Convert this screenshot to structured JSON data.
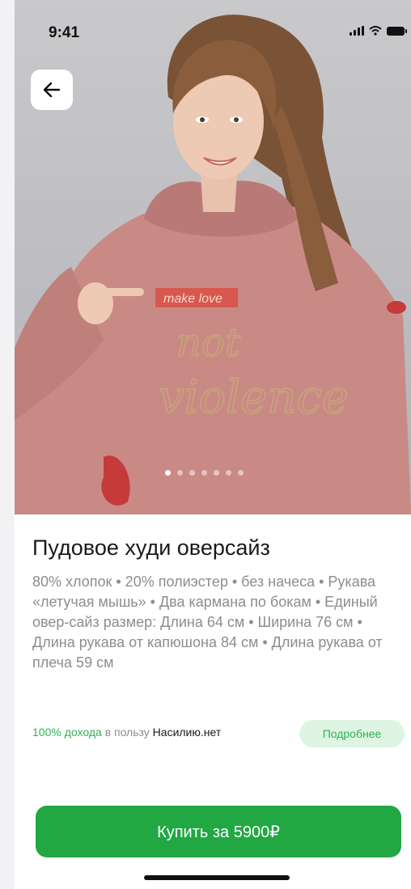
{
  "status_bar": {
    "time": "9:41"
  },
  "hero": {
    "print_text_1": "make love",
    "print_text_2": "not",
    "print_text_3": "violence",
    "carousel_total": 7,
    "carousel_active": 1
  },
  "product": {
    "title": "Пудовое худи оверсайз",
    "description": "80% хлопок • 20% полиэстер • без начеса • Рукава «летучая мышь» • Два кармана по бокам • Единый овер-сайз размер: Длина 64 см • Ширина 76 см • Длина рукава от капюшона 84 см • Длина рукава от плеча 59 см"
  },
  "charity": {
    "percent_text": "100% дохода",
    "middle_text": " в пользу ",
    "org_name": "Насилию.нет",
    "more_label": "Подробнее"
  },
  "buy": {
    "label": "Купить за 5900₽"
  },
  "colors": {
    "accent_green": "#21a843",
    "light_green": "#dff5e4",
    "hoodie_pink": "#c98a86"
  },
  "icons": [
    "back-arrow-icon",
    "signal-icon",
    "wifi-icon",
    "battery-icon"
  ]
}
